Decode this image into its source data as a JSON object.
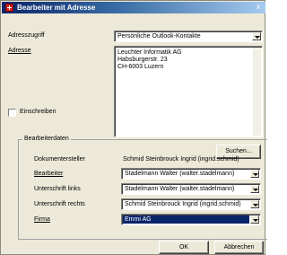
{
  "window": {
    "title": "Bearbeiter mit Adresse",
    "close": "x"
  },
  "address_access": {
    "label": "Adresszugriff",
    "value": "Persönliche Outlook-Kontakte"
  },
  "address": {
    "label": "Adresse",
    "lines": [
      "Leuchter Informatik AG",
      "Habsburgerstr. 23",
      "CH-6003 Luzern"
    ]
  },
  "register": {
    "label": "Einschreiben",
    "checked": false
  },
  "search_button": {
    "label": "Suchen..."
  },
  "group": {
    "title": "Bearbeiterdaten",
    "document_creator": {
      "label": "Dokumentersteller",
      "value": "Schmid Steinbrouck Ingrid (ingrid.schmid)"
    },
    "editor": {
      "label": "Bearbeiter",
      "value": "Stadelmann Walter (walter.stadelmann)"
    },
    "signature_left": {
      "label": "Unterschrift links",
      "value": "Stadelmann Walter (walter.stadelmann)"
    },
    "signature_right": {
      "label": "Unterschrift rechts",
      "value": "Schmid Steinbrouck Ingrid (ingrid.schmid)"
    },
    "company": {
      "label": "Firma",
      "value": "Emmi AG"
    }
  },
  "ok_button": {
    "label": "OK"
  },
  "cancel_button": {
    "label": "Abbrechen"
  },
  "colors": {
    "title_bar": "#0a246a",
    "selected_bg": "#0a246a",
    "dialog_bg": "#ece9d8"
  }
}
